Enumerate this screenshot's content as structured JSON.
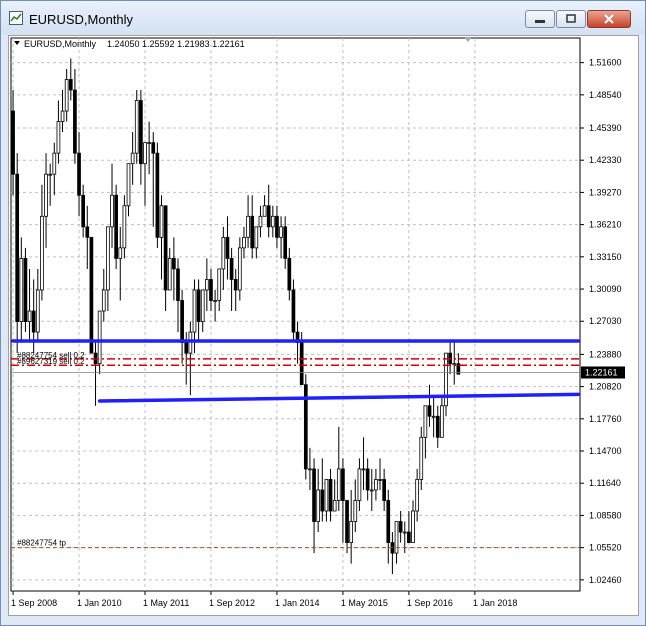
{
  "window": {
    "title": "EURUSD,Monthly"
  },
  "header": {
    "symbol": "EURUSD,Monthly",
    "ohlc": "1.24050 1.25592 1.21983 1.22161"
  },
  "colors": {
    "candle": "#000000",
    "trendline": "#2020ff",
    "order": "#d00000",
    "tp": "#a0522d",
    "grid": "#c0c0c0",
    "price_tag_bg": "#000000"
  },
  "chart_data": {
    "type": "candlestick",
    "title": "",
    "price_ticks": [
      "1.51600",
      "1.48540",
      "1.45390",
      "1.42330",
      "1.39270",
      "1.36210",
      "1.33150",
      "1.30090",
      "1.27030",
      "1.23880",
      "1.20820",
      "1.17760",
      "1.14700",
      "1.11640",
      "1.08580",
      "1.05520",
      "1.02460"
    ],
    "price_tick_values": [
      1.516,
      1.4854,
      1.4539,
      1.4233,
      1.3927,
      1.3621,
      1.3315,
      1.3009,
      1.2703,
      1.2388,
      1.2082,
      1.1776,
      1.147,
      1.1164,
      1.0858,
      1.0552,
      1.0246
    ],
    "ylim": [
      1.014,
      1.528
    ],
    "x_ticks": [
      "1 Sep 2008",
      "1 Jan 2010",
      "1 May 2011",
      "1 Sep 2012",
      "1 Jan 2014",
      "1 May 2015",
      "1 Sep 2016",
      "1 Jan 2018"
    ],
    "x_tick_index": [
      0,
      16,
      32,
      48,
      64,
      80,
      96,
      112
    ],
    "bar_count": 138,
    "current_price": "1.22161",
    "current_price_value": 1.22161,
    "order_lines": [
      {
        "label": "#88247754 sell 0.2",
        "price": 1.2345
      },
      {
        "label": "#89627319 sell 0.2",
        "price": 1.2285
      }
    ],
    "tp_line": {
      "label": "#88247754 tp",
      "price": 1.0552
    },
    "trendlines": [
      {
        "from_index": 0,
        "to_index": 138,
        "price_from": 1.2515,
        "price_to": 1.2515
      },
      {
        "from_index": 21,
        "to_index": 138,
        "price_from": 1.1945,
        "price_to": 1.2008
      }
    ],
    "candles": [
      [
        1.47,
        1.49,
        1.39,
        1.41
      ],
      [
        1.41,
        1.43,
        1.24,
        1.27
      ],
      [
        1.27,
        1.35,
        1.25,
        1.33
      ],
      [
        1.33,
        1.34,
        1.26,
        1.27
      ],
      [
        1.27,
        1.32,
        1.25,
        1.28
      ],
      [
        1.28,
        1.31,
        1.24,
        1.26
      ],
      [
        1.26,
        1.32,
        1.25,
        1.3
      ],
      [
        1.3,
        1.4,
        1.29,
        1.37
      ],
      [
        1.37,
        1.43,
        1.34,
        1.41
      ],
      [
        1.41,
        1.42,
        1.38,
        1.41
      ],
      [
        1.41,
        1.44,
        1.39,
        1.43
      ],
      [
        1.43,
        1.48,
        1.42,
        1.46
      ],
      [
        1.46,
        1.49,
        1.45,
        1.47
      ],
      [
        1.47,
        1.51,
        1.46,
        1.5
      ],
      [
        1.5,
        1.52,
        1.48,
        1.49
      ],
      [
        1.49,
        1.51,
        1.42,
        1.43
      ],
      [
        1.43,
        1.45,
        1.37,
        1.39
      ],
      [
        1.39,
        1.4,
        1.35,
        1.36
      ],
      [
        1.36,
        1.38,
        1.32,
        1.35
      ],
      [
        1.35,
        1.35,
        1.24,
        1.24
      ],
      [
        1.24,
        1.25,
        1.19,
        1.23
      ],
      [
        1.23,
        1.28,
        1.22,
        1.28
      ],
      [
        1.28,
        1.32,
        1.27,
        1.3
      ],
      [
        1.3,
        1.35,
        1.28,
        1.36
      ],
      [
        1.36,
        1.42,
        1.34,
        1.39
      ],
      [
        1.39,
        1.4,
        1.32,
        1.33
      ],
      [
        1.33,
        1.36,
        1.29,
        1.34
      ],
      [
        1.34,
        1.39,
        1.33,
        1.38
      ],
      [
        1.38,
        1.42,
        1.37,
        1.42
      ],
      [
        1.42,
        1.45,
        1.4,
        1.43
      ],
      [
        1.43,
        1.49,
        1.42,
        1.48
      ],
      [
        1.48,
        1.49,
        1.4,
        1.42
      ],
      [
        1.42,
        1.44,
        1.38,
        1.44
      ],
      [
        1.44,
        1.46,
        1.41,
        1.44
      ],
      [
        1.44,
        1.45,
        1.36,
        1.43
      ],
      [
        1.43,
        1.44,
        1.34,
        1.35
      ],
      [
        1.35,
        1.39,
        1.31,
        1.38
      ],
      [
        1.38,
        1.38,
        1.28,
        1.3
      ],
      [
        1.3,
        1.34,
        1.3,
        1.33
      ],
      [
        1.33,
        1.35,
        1.29,
        1.32
      ],
      [
        1.32,
        1.33,
        1.26,
        1.29
      ],
      [
        1.29,
        1.3,
        1.23,
        1.25
      ],
      [
        1.25,
        1.26,
        1.21,
        1.24
      ],
      [
        1.24,
        1.27,
        1.2,
        1.26
      ],
      [
        1.26,
        1.31,
        1.24,
        1.3
      ],
      [
        1.3,
        1.31,
        1.25,
        1.27
      ],
      [
        1.27,
        1.3,
        1.26,
        1.3
      ],
      [
        1.3,
        1.33,
        1.28,
        1.31
      ],
      [
        1.31,
        1.32,
        1.28,
        1.29
      ],
      [
        1.29,
        1.3,
        1.27,
        1.29
      ],
      [
        1.29,
        1.32,
        1.28,
        1.32
      ],
      [
        1.32,
        1.36,
        1.3,
        1.35
      ],
      [
        1.35,
        1.37,
        1.31,
        1.33
      ],
      [
        1.33,
        1.34,
        1.28,
        1.31
      ],
      [
        1.31,
        1.32,
        1.28,
        1.3
      ],
      [
        1.3,
        1.35,
        1.29,
        1.34
      ],
      [
        1.34,
        1.36,
        1.33,
        1.35
      ],
      [
        1.35,
        1.39,
        1.34,
        1.37
      ],
      [
        1.37,
        1.39,
        1.33,
        1.34
      ],
      [
        1.34,
        1.36,
        1.33,
        1.36
      ],
      [
        1.36,
        1.38,
        1.35,
        1.37
      ],
      [
        1.37,
        1.39,
        1.37,
        1.38
      ],
      [
        1.38,
        1.4,
        1.35,
        1.36
      ],
      [
        1.36,
        1.38,
        1.35,
        1.37
      ],
      [
        1.37,
        1.38,
        1.34,
        1.35
      ],
      [
        1.35,
        1.37,
        1.33,
        1.36
      ],
      [
        1.36,
        1.37,
        1.32,
        1.33
      ],
      [
        1.33,
        1.34,
        1.29,
        1.3
      ],
      [
        1.3,
        1.31,
        1.25,
        1.26
      ],
      [
        1.26,
        1.27,
        1.23,
        1.25
      ],
      [
        1.25,
        1.26,
        1.21,
        1.21
      ],
      [
        1.21,
        1.22,
        1.12,
        1.13
      ],
      [
        1.13,
        1.15,
        1.11,
        1.13
      ],
      [
        1.13,
        1.14,
        1.05,
        1.08
      ],
      [
        1.08,
        1.13,
        1.07,
        1.11
      ],
      [
        1.11,
        1.14,
        1.08,
        1.09
      ],
      [
        1.09,
        1.12,
        1.08,
        1.12
      ],
      [
        1.12,
        1.13,
        1.08,
        1.09
      ],
      [
        1.09,
        1.12,
        1.09,
        1.1
      ],
      [
        1.1,
        1.17,
        1.09,
        1.13
      ],
      [
        1.13,
        1.14,
        1.06,
        1.1
      ],
      [
        1.1,
        1.1,
        1.05,
        1.06
      ],
      [
        1.06,
        1.11,
        1.04,
        1.08
      ],
      [
        1.08,
        1.12,
        1.07,
        1.1
      ],
      [
        1.1,
        1.14,
        1.09,
        1.13
      ],
      [
        1.13,
        1.16,
        1.11,
        1.13
      ],
      [
        1.13,
        1.14,
        1.1,
        1.11
      ],
      [
        1.11,
        1.13,
        1.09,
        1.11
      ],
      [
        1.11,
        1.13,
        1.1,
        1.12
      ],
      [
        1.12,
        1.14,
        1.11,
        1.12
      ],
      [
        1.12,
        1.13,
        1.09,
        1.1
      ],
      [
        1.1,
        1.11,
        1.04,
        1.06
      ],
      [
        1.06,
        1.07,
        1.03,
        1.05
      ],
      [
        1.05,
        1.08,
        1.04,
        1.08
      ],
      [
        1.08,
        1.09,
        1.06,
        1.07
      ],
      [
        1.07,
        1.08,
        1.05,
        1.07
      ],
      [
        1.07,
        1.09,
        1.06,
        1.06
      ],
      [
        1.06,
        1.1,
        1.06,
        1.09
      ],
      [
        1.09,
        1.13,
        1.08,
        1.12
      ],
      [
        1.12,
        1.17,
        1.11,
        1.16
      ],
      [
        1.16,
        1.19,
        1.14,
        1.19
      ],
      [
        1.19,
        1.21,
        1.17,
        1.18
      ],
      [
        1.18,
        1.2,
        1.16,
        1.18
      ],
      [
        1.18,
        1.19,
        1.15,
        1.16
      ],
      [
        1.16,
        1.2,
        1.16,
        1.19
      ],
      [
        1.19,
        1.24,
        1.18,
        1.24
      ],
      [
        1.24,
        1.25,
        1.22,
        1.23
      ],
      [
        1.23,
        1.25,
        1.21,
        1.23
      ],
      [
        1.23,
        1.24,
        1.22,
        1.22
      ]
    ]
  }
}
